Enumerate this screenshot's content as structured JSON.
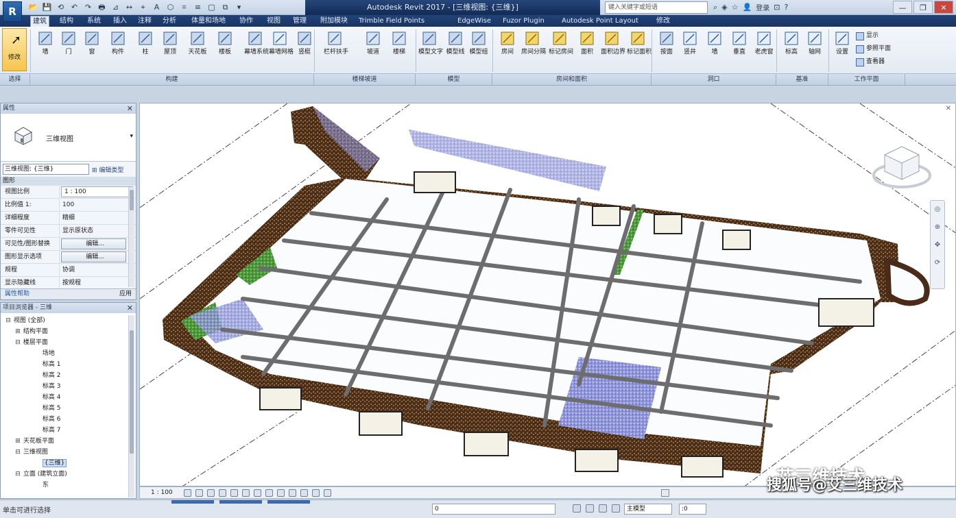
{
  "app": {
    "logo_letter": "R",
    "title": "Autodesk Revit 2017 -   [三维视图: {三维}]",
    "search_placeholder": "键入关键字或短语",
    "user": "登录"
  },
  "qat_icons": [
    "open-icon",
    "save-icon",
    "sync-icon",
    "undo-icon",
    "redo-icon",
    "print-icon",
    "measure-icon",
    "dimension-icon",
    "tag-icon",
    "text-icon",
    "3d-view-icon",
    "section-icon",
    "thin-lines-icon",
    "close-hidden-icon",
    "switch-window-icon",
    "customize-icon"
  ],
  "ribbon_tabs": [
    "建筑",
    "结构",
    "系统",
    "插入",
    "注释",
    "分析",
    "体量和场地",
    "协作",
    "视图",
    "管理",
    "附加模块",
    "Trimble Field Points",
    "EdgeWise",
    "Fuzor Plugin",
    "Autodesk Point Layout",
    "修改"
  ],
  "ribbon_tab_active": 0,
  "ribbon": {
    "modify_label": "修改",
    "buttons": [
      {
        "label": "墙",
        "icon": "wall-icon"
      },
      {
        "label": "门",
        "icon": "door-icon"
      },
      {
        "label": "窗",
        "icon": "window-icon"
      },
      {
        "label": "构件",
        "icon": "component-icon"
      },
      {
        "label": "柱",
        "icon": "column-icon"
      },
      {
        "label": "屋顶",
        "icon": "roof-icon"
      },
      {
        "label": "天花板",
        "icon": "ceiling-icon"
      },
      {
        "label": "楼板",
        "icon": "floor-icon"
      },
      {
        "label": "幕墙系统",
        "icon": "curtain-system-icon"
      },
      {
        "label": "幕墙网格",
        "icon": "curtain-grid-icon"
      },
      {
        "label": "竖梃",
        "icon": "mullion-icon"
      },
      {
        "label": "栏杆扶手",
        "icon": "railing-icon"
      },
      {
        "label": "坡道",
        "icon": "ramp-icon"
      },
      {
        "label": "楼梯",
        "icon": "stair-icon"
      },
      {
        "label": "模型文字",
        "icon": "model-text-icon"
      },
      {
        "label": "模型线",
        "icon": "model-line-icon"
      },
      {
        "label": "模型组",
        "icon": "model-group-icon"
      },
      {
        "label": "房间",
        "icon": "room-icon"
      },
      {
        "label": "房间分隔",
        "icon": "room-separator-icon"
      },
      {
        "label": "标记房间",
        "icon": "tag-room-icon"
      },
      {
        "label": "面积",
        "icon": "area-icon"
      },
      {
        "label": "面积边界",
        "icon": "area-boundary-icon"
      },
      {
        "label": "标记面积",
        "icon": "tag-area-icon"
      },
      {
        "label": "按面",
        "icon": "by-face-icon"
      },
      {
        "label": "竖井",
        "icon": "shaft-icon"
      },
      {
        "label": "墙",
        "icon": "wall-opening-icon"
      },
      {
        "label": "垂直",
        "icon": "vertical-opening-icon"
      },
      {
        "label": "老虎窗",
        "icon": "dormer-icon"
      },
      {
        "label": "标高",
        "icon": "level-icon"
      },
      {
        "label": "轴网",
        "icon": "grid-icon"
      },
      {
        "label": "设置",
        "icon": "set-workplane-icon"
      }
    ],
    "workplane_items": [
      "显示",
      "参照平面",
      "查看器"
    ],
    "panels": [
      "选择",
      "构建",
      "楼梯坡道",
      "模型",
      "房间和面积",
      "洞口",
      "基准",
      "工作平面"
    ]
  },
  "properties": {
    "header": "属性",
    "type_name": "三维视图",
    "view_select": "三维视图: {三维}",
    "edit_type": "编辑类型",
    "category": "图形",
    "rows": [
      {
        "key": "视图比例",
        "value": "1 : 100",
        "kind": "input"
      },
      {
        "key": "比例值 1:",
        "value": "100",
        "kind": "text"
      },
      {
        "key": "详细程度",
        "value": "精细",
        "kind": "text"
      },
      {
        "key": "零件可见性",
        "value": "显示原状态",
        "kind": "text"
      },
      {
        "key": "可见性/图形替换",
        "value": "编辑...",
        "kind": "btn"
      },
      {
        "key": "图形显示选项",
        "value": "编辑...",
        "kind": "btn"
      },
      {
        "key": "规程",
        "value": "协调",
        "kind": "text"
      },
      {
        "key": "显示隐藏线",
        "value": "按规程",
        "kind": "text"
      }
    ],
    "help_link": "属性帮助",
    "apply": "应用"
  },
  "browser": {
    "header": "项目浏览器 - 三维",
    "nodes": [
      {
        "indent": 0,
        "exp": "⊟",
        "text": "视图 (全部)"
      },
      {
        "indent": 1,
        "exp": "⊞",
        "text": "结构平面"
      },
      {
        "indent": 1,
        "exp": "⊟",
        "text": "楼层平面"
      },
      {
        "indent": 3,
        "exp": "",
        "text": "场地"
      },
      {
        "indent": 3,
        "exp": "",
        "text": "标高 1"
      },
      {
        "indent": 3,
        "exp": "",
        "text": "标高 2"
      },
      {
        "indent": 3,
        "exp": "",
        "text": "标高 3"
      },
      {
        "indent": 3,
        "exp": "",
        "text": "标高 4"
      },
      {
        "indent": 3,
        "exp": "",
        "text": "标高 5"
      },
      {
        "indent": 3,
        "exp": "",
        "text": "标高 6"
      },
      {
        "indent": 3,
        "exp": "",
        "text": "标高 7"
      },
      {
        "indent": 1,
        "exp": "⊞",
        "text": "天花板平面"
      },
      {
        "indent": 1,
        "exp": "⊟",
        "text": "三维视图"
      },
      {
        "indent": 3,
        "exp": "",
        "text": "{三维}",
        "selected": true
      },
      {
        "indent": 1,
        "exp": "⊟",
        "text": "立面 (建筑立面)"
      },
      {
        "indent": 3,
        "exp": "",
        "text": "东"
      }
    ]
  },
  "view_control": {
    "scale": "1 : 100"
  },
  "status": {
    "message": "单击可进行选择",
    "model_combo": "主模型",
    "workset_combo": "0",
    "filter_combo": ":0"
  },
  "watermark": {
    "text": "搜狐号@艾三维技术",
    "logo_text": "艾三维技术"
  }
}
